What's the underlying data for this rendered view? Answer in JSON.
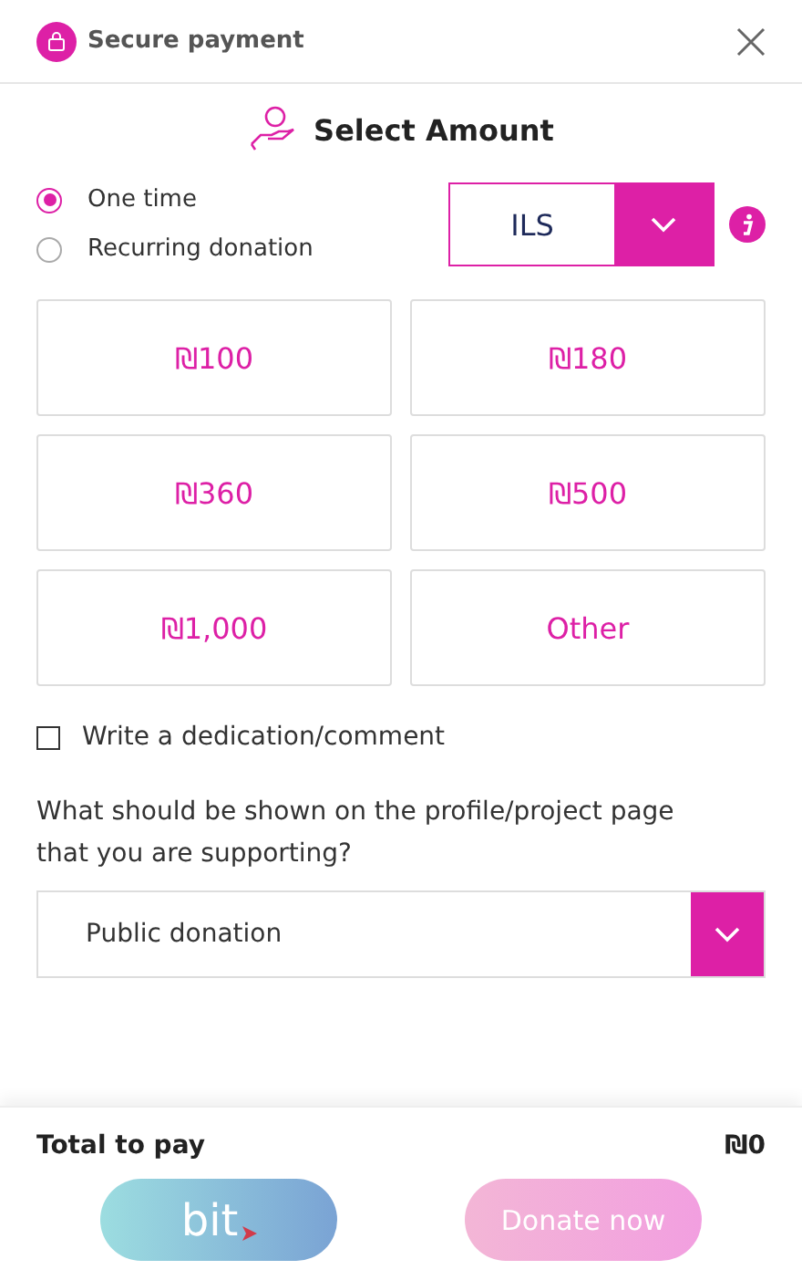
{
  "header": {
    "title": "Secure payment"
  },
  "heading": "Select Amount",
  "frequency": [
    {
      "label": "One time",
      "selected": true
    },
    {
      "label": "Recurring donation",
      "selected": false
    }
  ],
  "currency": {
    "value": "ILS"
  },
  "amounts": [
    {
      "label": "₪100",
      "selected": false
    },
    {
      "label": "₪180",
      "selected": false
    },
    {
      "label": "₪360",
      "selected": false
    },
    {
      "label": "₪500",
      "selected": false
    },
    {
      "label": "₪1,000",
      "selected": false
    },
    {
      "label": "Other",
      "selected": false
    }
  ],
  "dedication": {
    "label": "Write a dedication/comment",
    "checked": false
  },
  "visibility": {
    "question": "What should be shown on the profile/project page that you are supporting?",
    "value": "Public donation"
  },
  "footer": {
    "total_label": "Total to pay",
    "total": "₪0",
    "bit_label": "bit",
    "donate": {
      "label": "Donate now",
      "disabled": true
    }
  }
}
